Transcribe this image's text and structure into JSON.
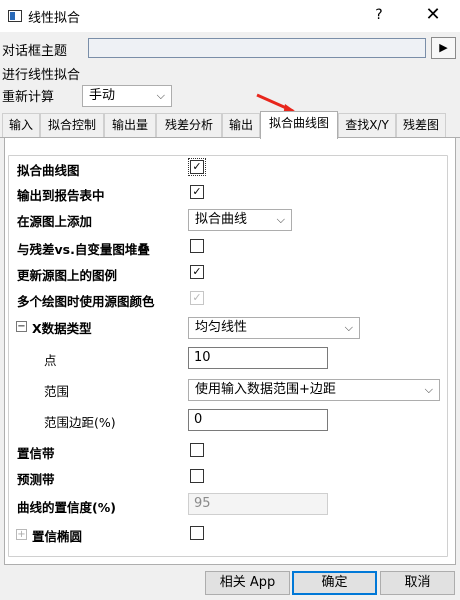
{
  "window": {
    "title": "线性拟合",
    "help": "?",
    "close": "✕"
  },
  "header": {
    "theme_label": "对话框主题",
    "theme_value": "",
    "arrow": "▶",
    "description": "进行线性拟合",
    "recalc_label": "重新计算",
    "recalc_value": "手动"
  },
  "tabs": [
    {
      "label": "输入"
    },
    {
      "label": "拟合控制"
    },
    {
      "label": "输出量"
    },
    {
      "label": "残差分析"
    },
    {
      "label": "输出"
    },
    {
      "label": "拟合曲线图"
    },
    {
      "label": "查找X/Y"
    },
    {
      "label": "残差图"
    }
  ],
  "active_tab": "拟合曲线图",
  "rows": {
    "fit_curve_plot": {
      "label": "拟合曲线图",
      "checked": true
    },
    "output_to_report": {
      "label": "输出到报告表中",
      "checked": true
    },
    "add_on_source": {
      "label": "在源图上添加",
      "value": "拟合曲线"
    },
    "stack_residual": {
      "label": "与残差vs.自变量图堆叠",
      "checked": false
    },
    "update_legend": {
      "label": "更新源图上的图例",
      "checked": true
    },
    "use_source_color": {
      "label": "多个绘图时使用源图颜色",
      "checked": true
    },
    "x_data_type": {
      "label": "X数据类型",
      "value": "均匀线性",
      "expander": "−"
    },
    "points": {
      "label": "点",
      "value": "10"
    },
    "range": {
      "label": "范围",
      "value": "使用输入数据范围+边距"
    },
    "range_margin": {
      "label": "范围边距(%)",
      "value": "0"
    },
    "confidence_band": {
      "label": "置信带",
      "checked": false
    },
    "prediction_band": {
      "label": "预测带",
      "checked": false
    },
    "curve_confidence": {
      "label": "曲线的置信度(%)",
      "value": "95"
    },
    "confidence_ellipse": {
      "label": "置信椭圆",
      "checked": false,
      "expander": "+"
    }
  },
  "buttons": {
    "app": "相关 App",
    "ok": "确定",
    "cancel": "取消"
  },
  "colors": {
    "accent": "#0078d7",
    "annotation": "#e8261c"
  }
}
